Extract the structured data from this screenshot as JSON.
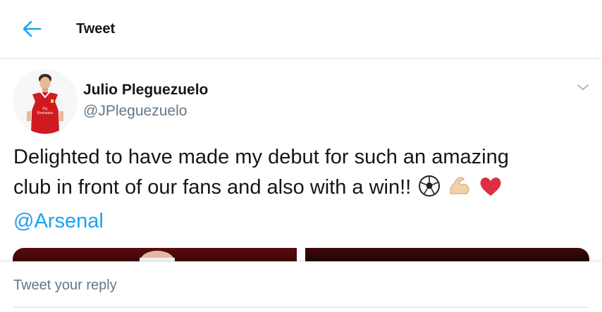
{
  "header": {
    "title": "Tweet",
    "back_icon": "arrow-left-icon",
    "accent_color": "#1da1f2"
  },
  "tweet": {
    "author": {
      "name": "Julio Pleguezuelo",
      "handle": "@JPleguezuelo",
      "avatar_icon": "avatar-player-in-red-kit"
    },
    "menu_icon": "chevron-down-icon",
    "text_line_1": "Delighted to have made my debut for such an amazing",
    "text_line_2": "club in front of our fans and also with a win!!",
    "emojis": [
      "soccer-ball-icon",
      "flexed-biceps-icon",
      "red-heart-icon"
    ],
    "mention": "@Arsenal",
    "media_count": 2
  },
  "reply": {
    "placeholder": "Tweet your reply"
  }
}
